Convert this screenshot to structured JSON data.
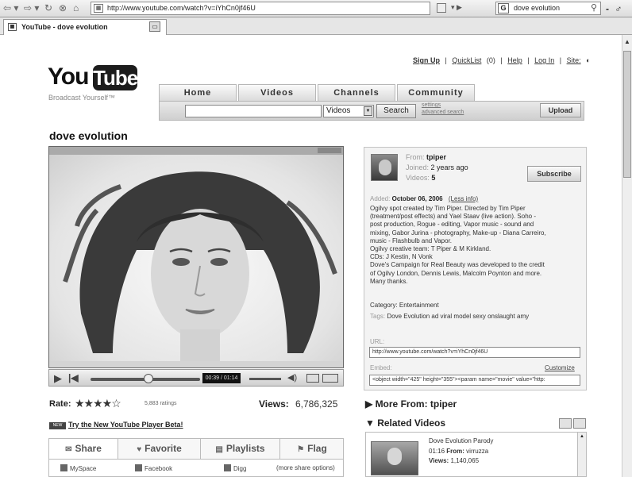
{
  "browser": {
    "address": "http://www.youtube.com/watch?v=iYhCn0jf46U",
    "search_text": "dove evolution",
    "tab_title": "YouTube - dove evolution",
    "window_controls": "- ♂ x"
  },
  "header": {
    "logo_you": "You",
    "logo_tube": "Tube",
    "tagline": "Broadcast Yourself™",
    "links": [
      "Sign Up",
      "|",
      "QuickList",
      "(0)",
      "|",
      "Help",
      "|",
      "Log In",
      "|",
      "Site:"
    ],
    "nav_tabs": [
      "Home",
      "Videos",
      "Channels",
      "Community"
    ],
    "search_type": "Videos",
    "search_button": "Search",
    "search_links": [
      "settings",
      "advanced search"
    ],
    "upload_button": "Upload"
  },
  "video": {
    "title": "dove evolution",
    "time": "00:39 / 01:14",
    "rating_label": "Rate:",
    "stars": "★★★★☆",
    "ratings_count": "5,883 ratings",
    "views_label": "Views:",
    "views_value": "6,786,325",
    "new_badge": "NEW",
    "new_player_link": "Try the New YouTube Player Beta!",
    "progress_fraction": 0.53
  },
  "actions": {
    "tabs": [
      "Share",
      "Favorite",
      "Playlists",
      "Flag"
    ],
    "share_links": [
      "MySpace",
      "Facebook",
      "Digg",
      "(more share options)"
    ]
  },
  "info": {
    "from_label": "From:",
    "from_value": "tpiper",
    "joined_label": "Joined:",
    "joined_value": "2 years ago",
    "videos_label": "Videos:",
    "videos_value": "5",
    "subscribe": "Subscribe",
    "added_label": "Added:",
    "added_value": "October 06, 2006",
    "less_info": "(Less info)",
    "description_lines": [
      "Ogilvy spot created by Tim Piper. Directed by Tim Piper",
      "(treatment/post effects) and Yael Staav (live action). Soho -",
      "post production, Rogue - editing, Vapor music - sound and",
      "mixing, Gabor Jurina - photography, Make-up - Diana Carreiro,",
      "music - Flashbulb and Vapor.",
      "Ogilvy creative team: T Piper & M Kirkland.",
      "CDs: J Kestin, N Vonk",
      "Dove's Campaign for Real Beauty was developed to the credit",
      "of Ogilvy London, Dennis Lewis, Malcolm Poynton and more.",
      "Many thanks."
    ],
    "category_label": "Category:",
    "category_value": "Entertainment",
    "tags_label": "Tags:",
    "tags_value": "Dove  Evolution  ad  viral  model  sexy  onslaught  amy",
    "url_label": "URL:",
    "url_value": "http://www.youtube.com/watch?v=iYhCn0jf46U",
    "embed_label": "Embed:",
    "customize": "Customize",
    "embed_value": "<object width=\"425\" height=\"355\"><param name=\"movie\" value=\"http:"
  },
  "sidebar": {
    "more_from": "▶ More From: tpiper",
    "related": "▼ Related Videos",
    "related_items": [
      {
        "title": "Dove Evolution Parody",
        "time": "01:16",
        "from_label": "From:",
        "from": "virruzza",
        "views_label": "Views:",
        "views": "1,140,065"
      }
    ]
  }
}
